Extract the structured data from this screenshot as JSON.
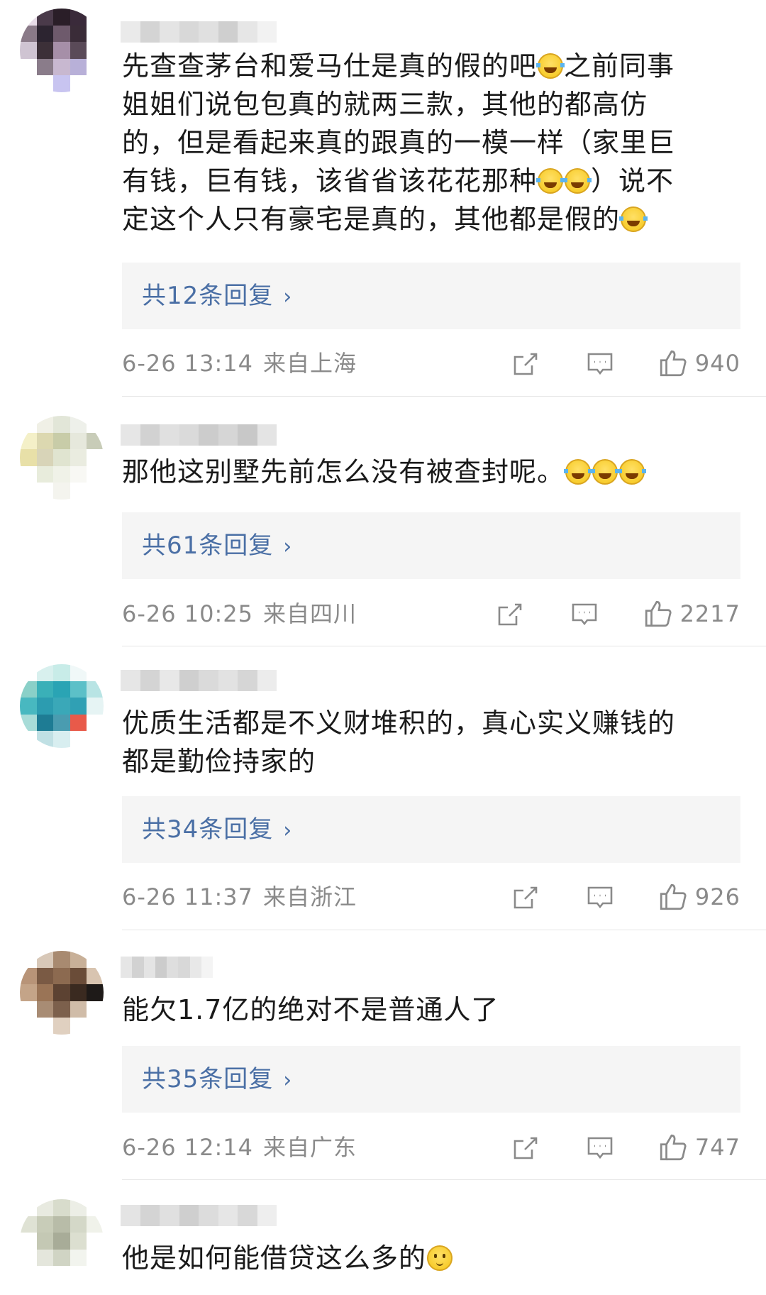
{
  "comments": [
    {
      "lines": [
        "先查查茅台和爱马仕是真的假的吧",
        "之前同事",
        "姐姐们说包包真的就两三款，其他的都高仿",
        "的，但是看起来真的跟真的一模一样（家里巨",
        "有钱，巨有钱，该省省该花花那种",
        "）说不",
        "定这个人只有豪宅是真的，其他都是假的"
      ],
      "replies": "共12条回复",
      "time": "6-26 13:14",
      "location": "来自上海",
      "likes": "940"
    },
    {
      "lines": [
        "那他这别墅先前怎么没有被查封呢。"
      ],
      "replies": "共61条回复",
      "time": "6-26 10:25",
      "location": "来自四川",
      "likes": "2217"
    },
    {
      "lines": [
        "优质生活都是不义财堆积的，真心实义赚钱的",
        "都是勤俭持家的"
      ],
      "replies": "共34条回复",
      "time": "6-26 11:37",
      "location": "来自浙江",
      "likes": "926"
    },
    {
      "lines": [
        "能欠1.7亿的绝对不是普通人了"
      ],
      "replies": "共35条回复",
      "time": "6-26 12:14",
      "location": "来自广东",
      "likes": "747"
    },
    {
      "lines": [
        "他是如何能借贷这么多的"
      ]
    }
  ],
  "icons": {
    "share": "share-icon",
    "comment": "comment-icon",
    "like": "thumbs-up-icon",
    "emoji_laugh_cry": "laugh-cry-emoji",
    "emoji_blush": "blush-emoji",
    "chevron": "chevron-right-icon"
  },
  "chevron_glyph": "›",
  "colors": {
    "reply_link": "#4a6fa5",
    "meta_text": "#8a8a8a",
    "reply_bg": "#f5f5f5",
    "divider": "#e6e6e6"
  }
}
